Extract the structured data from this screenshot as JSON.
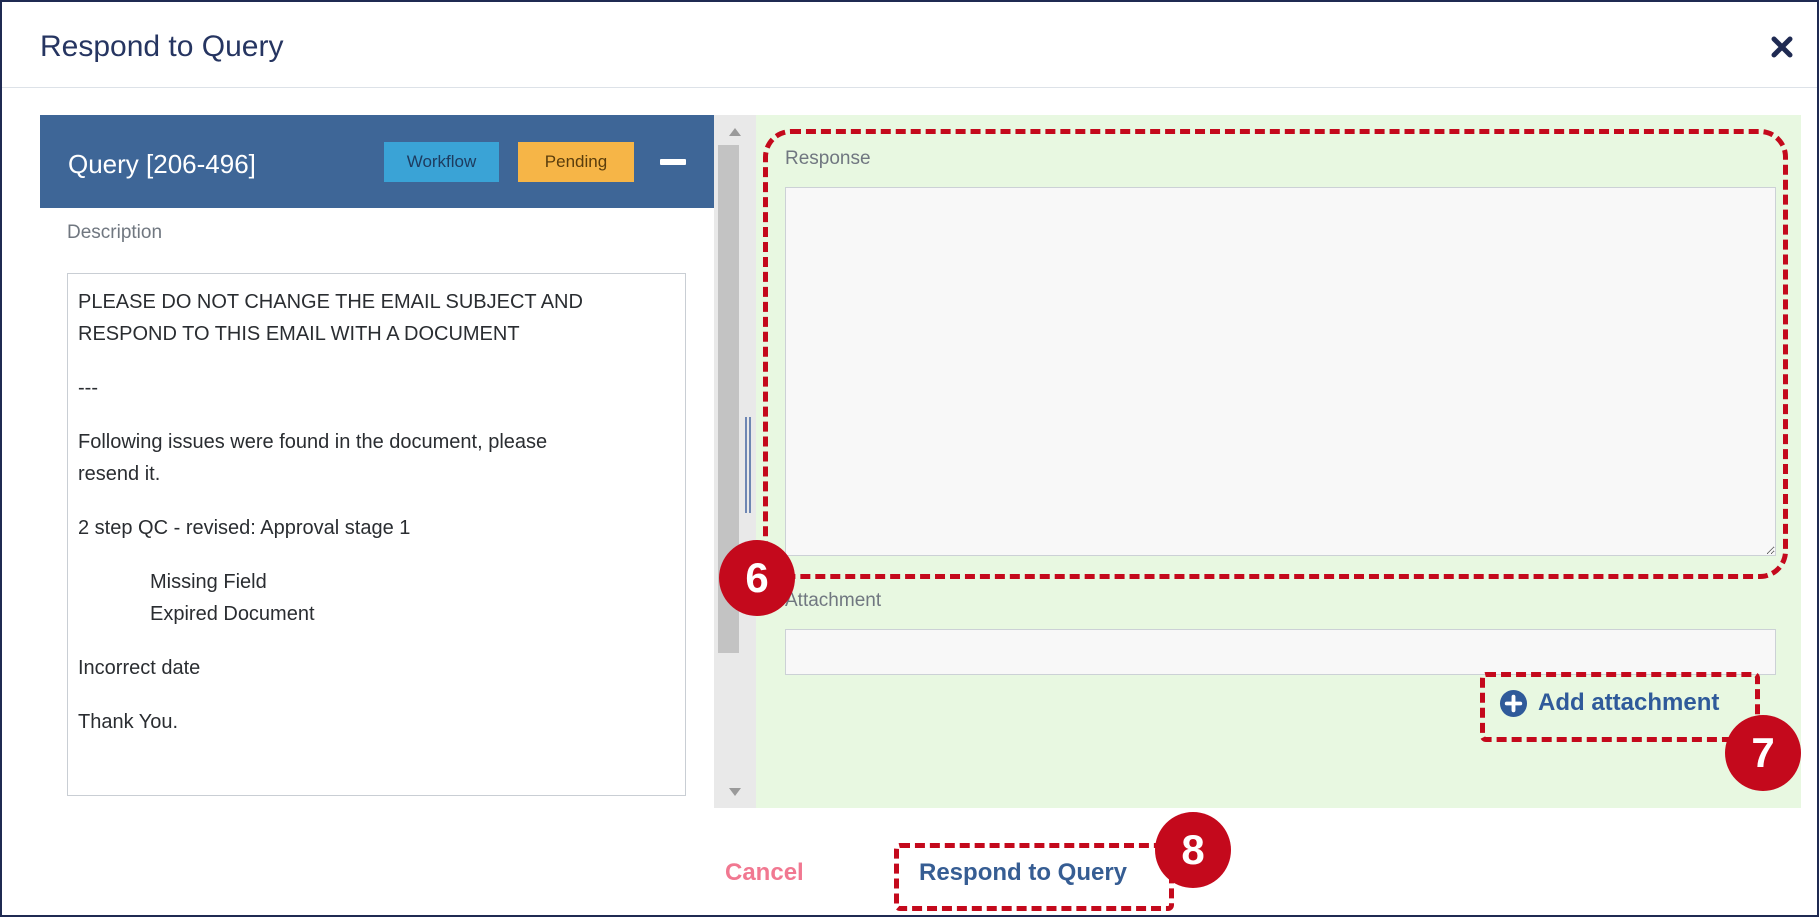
{
  "dialog": {
    "title": "Respond to Query",
    "close_icon": "close-icon"
  },
  "query": {
    "title": "Query [206-496]",
    "badges": [
      {
        "label": "Workflow",
        "color": "#3aa3d6"
      },
      {
        "label": "Pending",
        "color": "#f6b547"
      }
    ],
    "collapse_icon": "minus-icon",
    "header_color": "#3e6697"
  },
  "description": {
    "label": "Description",
    "lines": [
      "PLEASE DO NOT CHANGE THE EMAIL SUBJECT AND",
      "RESPOND TO THIS EMAIL WITH A DOCUMENT",
      "---",
      "Following issues were found in the document, please",
      "resend it.",
      "2 step QC - revised: Approval stage 1",
      "Missing Field",
      "Expired Document",
      "Incorrect date",
      "Thank You."
    ]
  },
  "form": {
    "response_label": "Response",
    "response_value": "",
    "attachment_label": "Attachment",
    "attachment_value": "",
    "add_attachment_label": "Add attachment",
    "add_attachment_icon": "plus-circle-icon",
    "panel_color": "#e8f8e1"
  },
  "footer": {
    "cancel_label": "Cancel",
    "respond_label": "Respond to Query",
    "cancel_color": "#f17891",
    "respond_color": "#365d93"
  },
  "annotations": {
    "color": "#c4091c",
    "markers": [
      {
        "label": "6"
      },
      {
        "label": "7"
      },
      {
        "label": "8"
      }
    ]
  }
}
